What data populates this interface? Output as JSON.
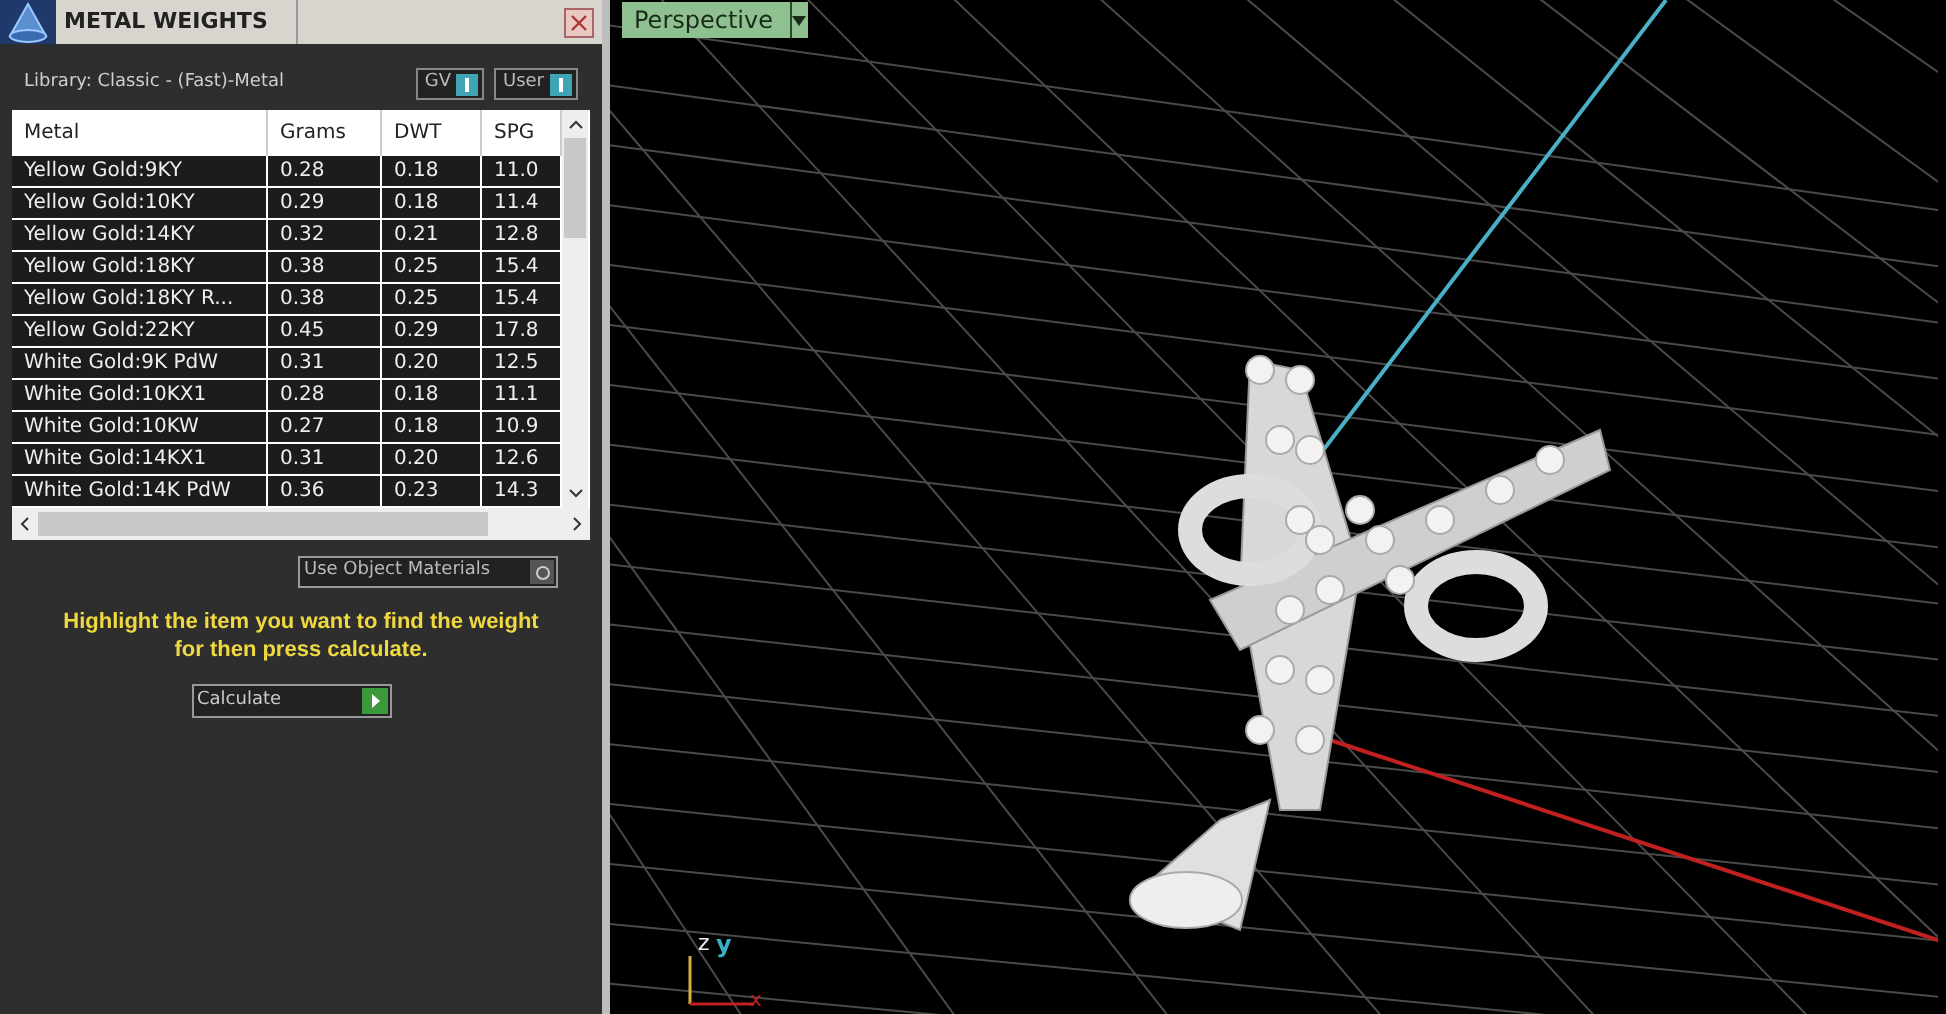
{
  "panel": {
    "title": "METAL WEIGHTS",
    "library": "Library: Classic - (Fast)-Metal",
    "toggles": [
      "GV",
      "User"
    ],
    "table": {
      "columns": [
        "Metal",
        "Grams",
        "DWT",
        "SPG"
      ],
      "rows": [
        [
          "Yellow Gold:9KY",
          "0.28",
          "0.18",
          "11.0"
        ],
        [
          "Yellow Gold:10KY",
          "0.29",
          "0.18",
          "11.4"
        ],
        [
          "Yellow Gold:14KY",
          "0.32",
          "0.21",
          "12.8"
        ],
        [
          "Yellow Gold:18KY",
          "0.38",
          "0.25",
          "15.4"
        ],
        [
          "Yellow Gold:18KY R...",
          "0.38",
          "0.25",
          "15.4"
        ],
        [
          "Yellow Gold:22KY",
          "0.45",
          "0.29",
          "17.8"
        ],
        [
          "White Gold:9K PdW",
          "0.31",
          "0.20",
          "12.5"
        ],
        [
          "White Gold:10KX1",
          "0.28",
          "0.18",
          "11.1"
        ],
        [
          "White Gold:10KW",
          "0.27",
          "0.18",
          "10.9"
        ],
        [
          "White Gold:14KX1",
          "0.31",
          "0.20",
          "12.6"
        ],
        [
          "White Gold:14K PdW",
          "0.36",
          "0.23",
          "14.3"
        ]
      ]
    },
    "use_object_materials": {
      "label": "Use Object Materials",
      "checked": false
    },
    "hint": "Highlight the item you want to find the weight for then press calculate.",
    "calculate": "Calculate"
  },
  "viewport": {
    "view": "Perspective",
    "axes": [
      "z",
      "y",
      "x"
    ]
  }
}
